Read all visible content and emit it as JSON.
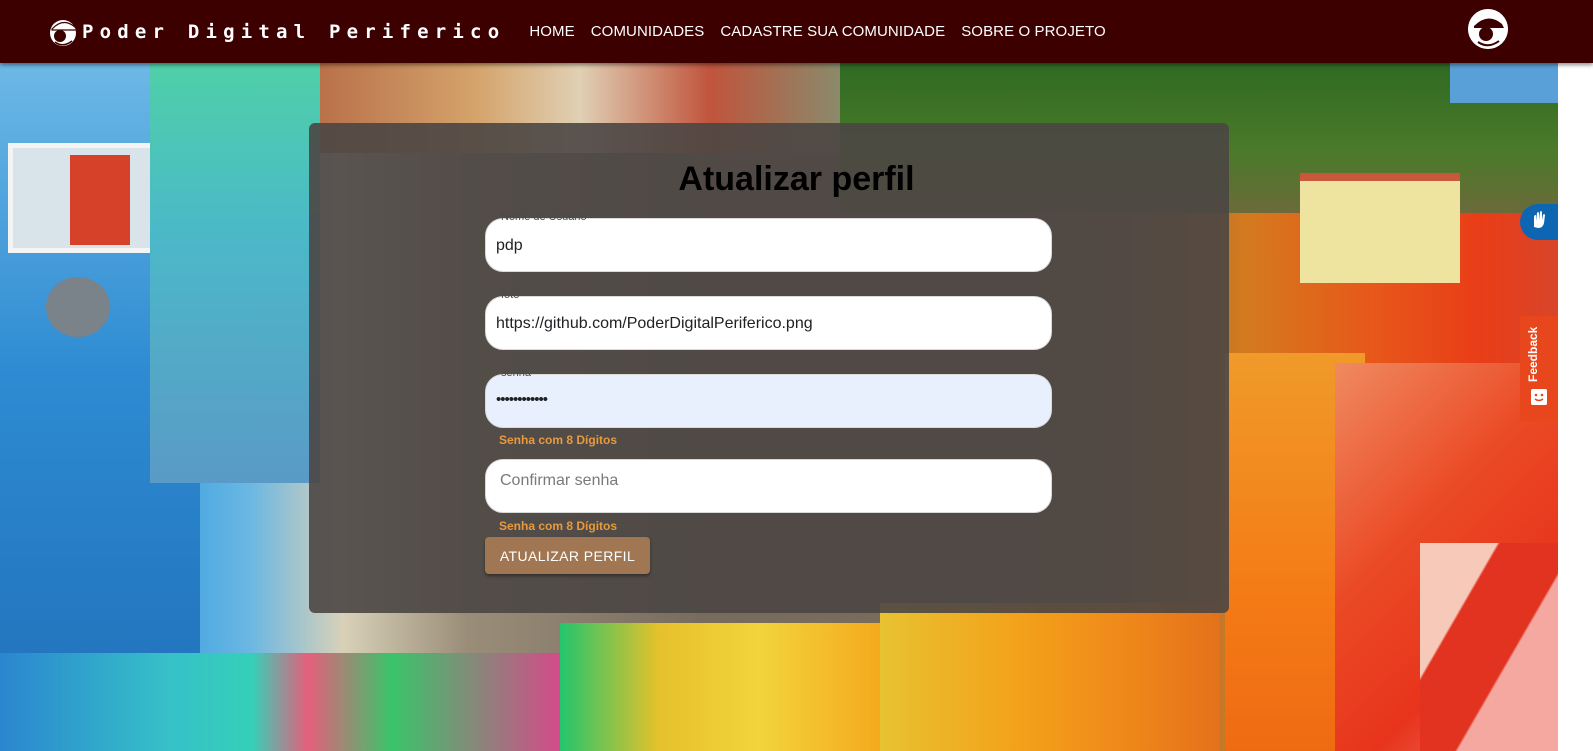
{
  "navbar": {
    "brand": "Poder Digital Periferico",
    "links": [
      "HOME",
      "COMUNIDADES",
      "CADASTRE SUA COMUNIDADE",
      "SOBRE O PROJETO"
    ],
    "logo_icon": "hat-person-icon",
    "avatar_icon": "profile-avatar-icon",
    "background_color": "#3c0000"
  },
  "form": {
    "title": "Atualizar perfil",
    "fields": {
      "username": {
        "label": "Nome de Usuário",
        "value": "pdp"
      },
      "photo": {
        "label": "foto",
        "value": "https://github.com/PoderDigitalPeriferico.png"
      },
      "password": {
        "label": "senha",
        "value": "••••••••••••"
      },
      "confirm": {
        "placeholder": "Confirmar senha"
      }
    },
    "password_hint": "Senha com 8 Dígitos",
    "confirm_hint": "Senha com 8 Dígitos",
    "submit_label": "ATUALIZAR PERFIL",
    "button_color": "#a07752",
    "hint_color": "#e79a3e"
  },
  "side_widgets": {
    "accessibility_icon": "hand-sign-language-icon",
    "feedback_label": "Feedback",
    "feedback_color": "#e8471d",
    "accessibility_color": "#0e66b3"
  }
}
